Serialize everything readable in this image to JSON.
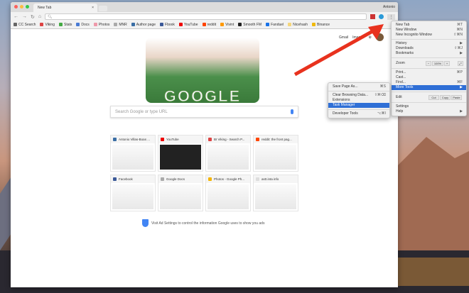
{
  "window": {
    "tab_title": "New Tab",
    "user": "Antonio",
    "omnibox": ""
  },
  "bookmarks": [
    {
      "label": "CC Search",
      "color": "#666"
    },
    {
      "label": "Viking",
      "color": "#d44"
    },
    {
      "label": "Stats",
      "color": "#4a4"
    },
    {
      "label": "Docs",
      "color": "#4a7bd4"
    },
    {
      "label": "Photos",
      "color": "#e9a"
    },
    {
      "label": "MNR",
      "color": "#aaa"
    },
    {
      "label": "Author page",
      "color": "#3a6ea5"
    },
    {
      "label": "Fbook",
      "color": "#3b5998"
    },
    {
      "label": "YouTube",
      "color": "#e00"
    },
    {
      "label": "reddit",
      "color": "#ff4500"
    },
    {
      "label": "Vivint",
      "color": "#f90"
    },
    {
      "label": "Smooth FM",
      "color": "#222"
    },
    {
      "label": "Fanduel",
      "color": "#1a73e8"
    },
    {
      "label": "Nicehash",
      "color": "#f5d67a"
    },
    {
      "label": "Binance",
      "color": "#f0b90b"
    }
  ],
  "google": {
    "links": [
      "Gmail",
      "Images"
    ],
    "logo": "GOOGLE",
    "search_placeholder": "Search Google or type URL",
    "ad_text": "Visit Ad Settings to control the information Google uses to show you ads"
  },
  "tiles": [
    {
      "title": "Antonio Villas-Boas ...",
      "color": "#3a6ea5"
    },
    {
      "title": "YouTube",
      "color": "#e00"
    },
    {
      "title": "BI Viking - Search P...",
      "color": "#d44"
    },
    {
      "title": "reddit: the front pag...",
      "color": "#ff4500"
    },
    {
      "title": "Facebook",
      "color": "#3b5998"
    },
    {
      "title": "Google Docs",
      "color": "#aaa"
    },
    {
      "title": "Photos - Google Ph...",
      "color": "#f4b400"
    },
    {
      "title": "as0.inta info",
      "color": "#ddd"
    }
  ],
  "menu": {
    "groups": [
      [
        {
          "label": "New Tab",
          "shortcut": "⌘T"
        },
        {
          "label": "New Window",
          "shortcut": "⌘N"
        },
        {
          "label": "New Incognito Window",
          "shortcut": "⇧⌘N"
        }
      ],
      [
        {
          "label": "History",
          "shortcut": "▶"
        },
        {
          "label": "Downloads",
          "shortcut": "⇧⌘J"
        },
        {
          "label": "Bookmarks",
          "shortcut": "▶"
        }
      ]
    ],
    "zoom": {
      "label": "Zoom",
      "minus": "−",
      "value": "100%",
      "plus": "+",
      "fullscreen": "⤢"
    },
    "group3": [
      {
        "label": "Print...",
        "shortcut": "⌘P"
      },
      {
        "label": "Cast...",
        "shortcut": ""
      },
      {
        "label": "Find...",
        "shortcut": "⌘F"
      },
      {
        "label": "More Tools",
        "shortcut": "▶",
        "selected": true
      }
    ],
    "edit": {
      "label": "Edit",
      "cut": "Cut",
      "copy": "Copy",
      "paste": "Paste"
    },
    "group4": [
      {
        "label": "Settings",
        "shortcut": ""
      },
      {
        "label": "Help",
        "shortcut": "▶"
      }
    ]
  },
  "submenu": [
    [
      {
        "label": "Save Page As...",
        "shortcut": "⌘S"
      }
    ],
    [
      {
        "label": "Clear Browsing Data...",
        "shortcut": "⇧⌘⌫"
      },
      {
        "label": "Extensions",
        "shortcut": ""
      },
      {
        "label": "Task Manager",
        "shortcut": "",
        "selected": true
      }
    ],
    [
      {
        "label": "Developer Tools",
        "shortcut": "⌥⌘I"
      }
    ]
  ],
  "colors": {
    "highlight": "#2f6fd6",
    "arrow": "#e8321e"
  }
}
